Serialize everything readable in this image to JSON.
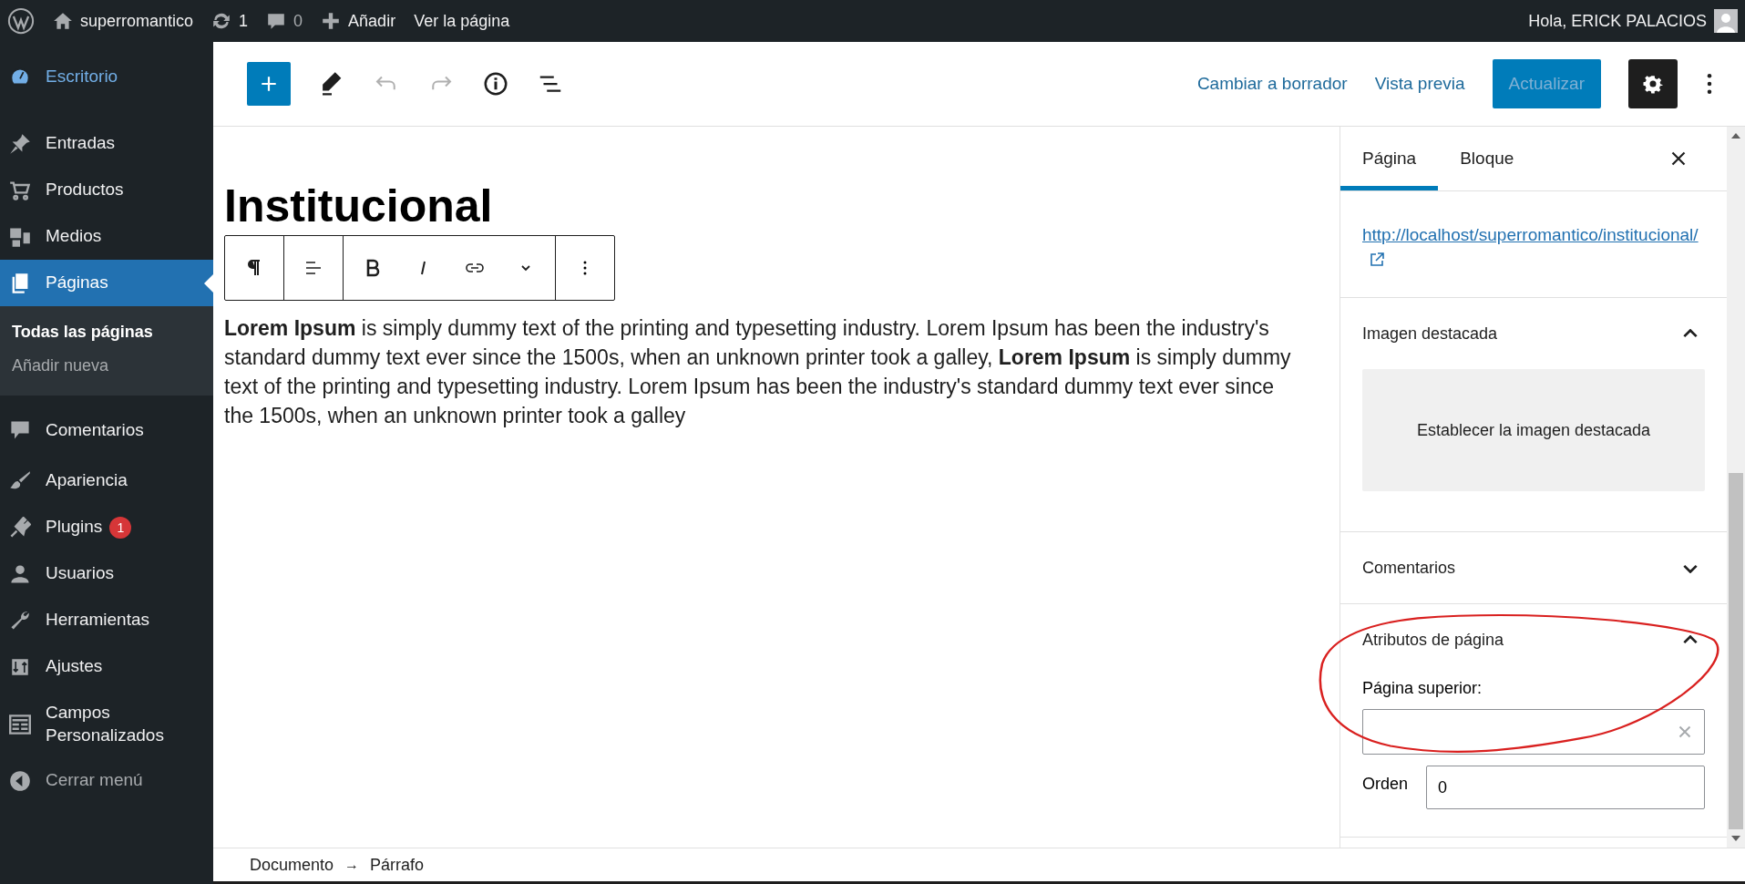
{
  "admin_bar": {
    "site": "superromantico",
    "updates": "1",
    "comments": "0",
    "add": "Añadir",
    "view": "Ver la página",
    "greeting": "Hola, ERICK PALACIOS"
  },
  "sidebar": {
    "items": [
      {
        "label": "Escritorio",
        "selected": false,
        "accent": true
      },
      {
        "label": "Entradas",
        "selected": false
      },
      {
        "label": "Productos",
        "selected": false
      },
      {
        "label": "Medios",
        "selected": false
      },
      {
        "label": "Páginas",
        "selected": true,
        "submenu": [
          {
            "label": "Todas las páginas",
            "selected": true
          },
          {
            "label": "Añadir nueva",
            "selected": false
          }
        ]
      },
      {
        "label": "Comentarios",
        "selected": false
      },
      {
        "label": "Apariencia",
        "selected": false
      },
      {
        "label": "Plugins",
        "selected": false,
        "badge": "1"
      },
      {
        "label": "Usuarios",
        "selected": false
      },
      {
        "label": "Herramientas",
        "selected": false
      },
      {
        "label": "Ajustes",
        "selected": false
      },
      {
        "label": "Campos Personalizados",
        "selected": false
      }
    ],
    "collapse": "Cerrar menú"
  },
  "header": {
    "undo_disabled": true,
    "redo_disabled": true,
    "links": [
      "Cambiar a borrador",
      "Vista previa"
    ],
    "update": {
      "label": "Actualizar",
      "disabled": true
    },
    "settings_selected": true
  },
  "editor": {
    "title": "Institucional",
    "paragraph": "**Lorem Ipsum** is simply dummy text of the printing and typesetting industry. Lorem Ipsum has been the industry's standard dummy text ever since the 1500s, when an unknown printer took a galley, **Lorem Ipsum** is simply dummy text of the printing and typesetting industry. Lorem Ipsum has been the industry's standard dummy text ever since the 1500s, when an unknown printer took a galley"
  },
  "panel": {
    "tabs": [
      {
        "label": "Página",
        "selected": true
      },
      {
        "label": "Bloque",
        "selected": false
      }
    ],
    "permalink": "http://localhost/superromantico/institucional/",
    "sections": [
      {
        "kind": "featured",
        "title": "Imagen destacada",
        "expanded": true,
        "button": "Establecer la imagen destacada"
      },
      {
        "kind": "plain",
        "title": "Comentarios",
        "expanded": false
      },
      {
        "kind": "attributes",
        "title": "Atributos de página",
        "expanded": true,
        "parent_label": "Página superior:",
        "order_label": "Orden",
        "order_value": "0"
      }
    ]
  },
  "breadcrumb": {
    "items": [
      "Documento",
      "Párrafo"
    ],
    "separator": "→"
  }
}
